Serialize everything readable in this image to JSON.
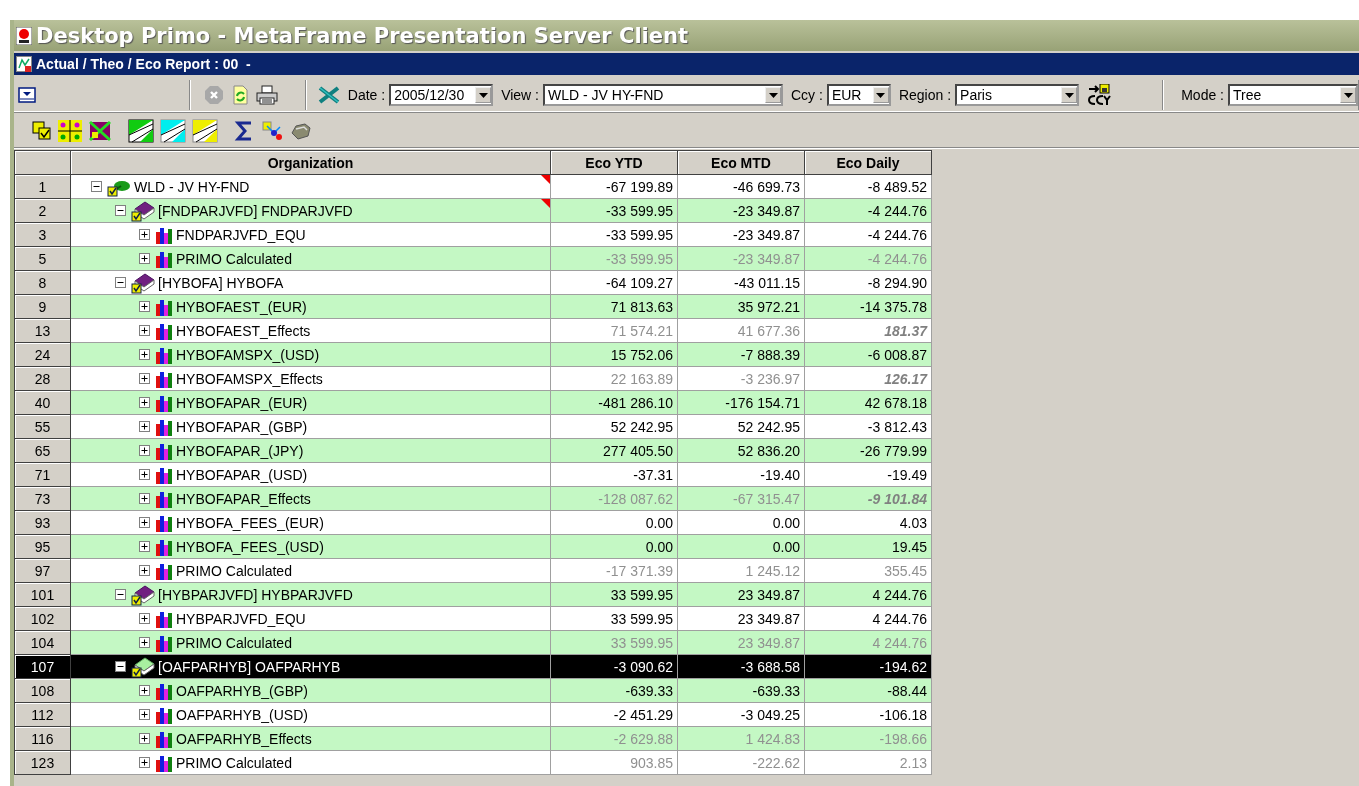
{
  "window": {
    "title": "Desktop Primo - MetaFrame Presentation Server Client"
  },
  "document": {
    "title": "Actual / Theo / Eco Report : 00  -"
  },
  "toolbar": {
    "filters": [
      {
        "label": "Date :",
        "value": "2005/12/30"
      },
      {
        "label": "View :",
        "value": "WLD - JV HY-FND"
      },
      {
        "label": "Ccy :",
        "value": "EUR"
      },
      {
        "label": "Region :",
        "value": "Paris"
      }
    ],
    "mode": {
      "label": "Mode :",
      "value": "Tree"
    }
  },
  "grid": {
    "columns": [
      "Organization",
      "Eco YTD",
      "Eco MTD",
      "Eco Daily"
    ],
    "rows": [
      {
        "number": "1",
        "label": "WLD - JV HY-FND",
        "kind": "root",
        "expanded": true,
        "selected": false,
        "flagged": true,
        "values": [
          {
            "text": "-67 199.89",
            "kind": "plain"
          },
          {
            "text": "-46 699.73",
            "kind": "plain"
          },
          {
            "text": "-8 489.52",
            "kind": "plain"
          }
        ],
        "children": [
          {
            "number": "2",
            "label": "[FNDPARJVFD] FNDPARJVFD",
            "kind": "book",
            "expanded": true,
            "selected": false,
            "flagged": true,
            "values": [
              {
                "text": "-33 599.95",
                "kind": "plain"
              },
              {
                "text": "-23 349.87",
                "kind": "plain"
              },
              {
                "text": "-4 244.76",
                "kind": "plain"
              }
            ],
            "children": [
              {
                "number": "3",
                "label": "FNDPARJVFD_EQU",
                "kind": "leaf",
                "expanded": false,
                "selected": false,
                "flagged": false,
                "values": [
                  {
                    "text": "-33 599.95",
                    "kind": "plain"
                  },
                  {
                    "text": "-23 349.87",
                    "kind": "plain"
                  },
                  {
                    "text": "-4 244.76",
                    "kind": "plain"
                  }
                ]
              },
              {
                "number": "5",
                "label": "PRIMO Calculated",
                "kind": "leaf",
                "expanded": false,
                "selected": false,
                "flagged": false,
                "values": [
                  {
                    "text": "-33 599.95",
                    "kind": "dim"
                  },
                  {
                    "text": "-23 349.87",
                    "kind": "dim"
                  },
                  {
                    "text": "-4 244.76",
                    "kind": "dim"
                  }
                ]
              }
            ]
          },
          {
            "number": "8",
            "label": "[HYBOFA] HYBOFA",
            "kind": "book",
            "expanded": true,
            "selected": false,
            "flagged": false,
            "values": [
              {
                "text": "-64 109.27",
                "kind": "plain"
              },
              {
                "text": "-43 011.15",
                "kind": "plain"
              },
              {
                "text": "-8 294.90",
                "kind": "plain"
              }
            ],
            "children": [
              {
                "number": "9",
                "label": "HYBOFAEST_(EUR)",
                "kind": "leaf",
                "expanded": false,
                "selected": false,
                "flagged": false,
                "values": [
                  {
                    "text": "71 813.63",
                    "kind": "plain"
                  },
                  {
                    "text": "35 972.21",
                    "kind": "plain"
                  },
                  {
                    "text": "-14 375.78",
                    "kind": "plain"
                  }
                ]
              },
              {
                "number": "13",
                "label": "HYBOFAEST_Effects",
                "kind": "leaf",
                "expanded": false,
                "selected": false,
                "flagged": false,
                "values": [
                  {
                    "text": "71 574.21",
                    "kind": "dim"
                  },
                  {
                    "text": "41 677.36",
                    "kind": "dim"
                  },
                  {
                    "text": "181.37",
                    "kind": "dim-bold"
                  }
                ]
              },
              {
                "number": "24",
                "label": "HYBOFAMSPX_(USD)",
                "kind": "leaf",
                "expanded": false,
                "selected": false,
                "flagged": false,
                "values": [
                  {
                    "text": "15 752.06",
                    "kind": "plain"
                  },
                  {
                    "text": "-7 888.39",
                    "kind": "plain"
                  },
                  {
                    "text": "-6 008.87",
                    "kind": "plain"
                  }
                ]
              },
              {
                "number": "28",
                "label": "HYBOFAMSPX_Effects",
                "kind": "leaf",
                "expanded": false,
                "selected": false,
                "flagged": false,
                "values": [
                  {
                    "text": "22 163.89",
                    "kind": "dim"
                  },
                  {
                    "text": "-3 236.97",
                    "kind": "dim"
                  },
                  {
                    "text": "126.17",
                    "kind": "dim-bold"
                  }
                ]
              },
              {
                "number": "40",
                "label": "HYBOFAPAR_(EUR)",
                "kind": "leaf",
                "expanded": false,
                "selected": false,
                "flagged": false,
                "values": [
                  {
                    "text": "-481 286.10",
                    "kind": "plain"
                  },
                  {
                    "text": "-176 154.71",
                    "kind": "plain"
                  },
                  {
                    "text": "42 678.18",
                    "kind": "plain"
                  }
                ]
              },
              {
                "number": "55",
                "label": "HYBOFAPAR_(GBP)",
                "kind": "leaf",
                "expanded": false,
                "selected": false,
                "flagged": false,
                "values": [
                  {
                    "text": "52 242.95",
                    "kind": "plain"
                  },
                  {
                    "text": "52 242.95",
                    "kind": "plain"
                  },
                  {
                    "text": "-3 812.43",
                    "kind": "plain"
                  }
                ]
              },
              {
                "number": "65",
                "label": "HYBOFAPAR_(JPY)",
                "kind": "leaf",
                "expanded": false,
                "selected": false,
                "flagged": false,
                "values": [
                  {
                    "text": "277 405.50",
                    "kind": "plain"
                  },
                  {
                    "text": "52 836.20",
                    "kind": "plain"
                  },
                  {
                    "text": "-26 779.99",
                    "kind": "plain"
                  }
                ]
              },
              {
                "number": "71",
                "label": "HYBOFAPAR_(USD)",
                "kind": "leaf",
                "expanded": false,
                "selected": false,
                "flagged": false,
                "values": [
                  {
                    "text": "-37.31",
                    "kind": "plain"
                  },
                  {
                    "text": "-19.40",
                    "kind": "plain"
                  },
                  {
                    "text": "-19.49",
                    "kind": "plain"
                  }
                ]
              },
              {
                "number": "73",
                "label": "HYBOFAPAR_Effects",
                "kind": "leaf",
                "expanded": false,
                "selected": false,
                "flagged": false,
                "values": [
                  {
                    "text": "-128 087.62",
                    "kind": "dim"
                  },
                  {
                    "text": "-67 315.47",
                    "kind": "dim"
                  },
                  {
                    "text": "-9 101.84",
                    "kind": "dim-bold"
                  }
                ]
              },
              {
                "number": "93",
                "label": "HYBOFA_FEES_(EUR)",
                "kind": "leaf",
                "expanded": false,
                "selected": false,
                "flagged": false,
                "values": [
                  {
                    "text": "0.00",
                    "kind": "plain"
                  },
                  {
                    "text": "0.00",
                    "kind": "plain"
                  },
                  {
                    "text": "4.03",
                    "kind": "plain"
                  }
                ]
              },
              {
                "number": "95",
                "label": "HYBOFA_FEES_(USD)",
                "kind": "leaf",
                "expanded": false,
                "selected": false,
                "flagged": false,
                "values": [
                  {
                    "text": "0.00",
                    "kind": "plain"
                  },
                  {
                    "text": "0.00",
                    "kind": "plain"
                  },
                  {
                    "text": "19.45",
                    "kind": "plain"
                  }
                ]
              },
              {
                "number": "97",
                "label": "PRIMO Calculated",
                "kind": "leaf",
                "expanded": false,
                "selected": false,
                "flagged": false,
                "values": [
                  {
                    "text": "-17 371.39",
                    "kind": "dim"
                  },
                  {
                    "text": "1 245.12",
                    "kind": "dim"
                  },
                  {
                    "text": "355.45",
                    "kind": "dim"
                  }
                ]
              }
            ]
          },
          {
            "number": "101",
            "label": "[HYBPARJVFD] HYBPARJVFD",
            "kind": "book",
            "expanded": true,
            "selected": false,
            "flagged": false,
            "values": [
              {
                "text": "33 599.95",
                "kind": "plain"
              },
              {
                "text": "23 349.87",
                "kind": "plain"
              },
              {
                "text": "4 244.76",
                "kind": "plain"
              }
            ],
            "children": [
              {
                "number": "102",
                "label": "HYBPARJVFD_EQU",
                "kind": "leaf",
                "expanded": false,
                "selected": false,
                "flagged": false,
                "values": [
                  {
                    "text": "33 599.95",
                    "kind": "plain"
                  },
                  {
                    "text": "23 349.87",
                    "kind": "plain"
                  },
                  {
                    "text": "4 244.76",
                    "kind": "plain"
                  }
                ]
              },
              {
                "number": "104",
                "label": "PRIMO Calculated",
                "kind": "leaf",
                "expanded": false,
                "selected": false,
                "flagged": false,
                "values": [
                  {
                    "text": "33 599.95",
                    "kind": "dim"
                  },
                  {
                    "text": "23 349.87",
                    "kind": "dim"
                  },
                  {
                    "text": "4 244.76",
                    "kind": "dim"
                  }
                ]
              }
            ]
          },
          {
            "number": "107",
            "label": "[OAFPARHYB] OAFPARHYB",
            "kind": "book",
            "expanded": true,
            "selected": true,
            "flagged": false,
            "values": [
              {
                "text": "-3 090.62",
                "kind": "plain"
              },
              {
                "text": "-3 688.58",
                "kind": "plain"
              },
              {
                "text": "-194.62",
                "kind": "plain"
              }
            ],
            "children": [
              {
                "number": "108",
                "label": "OAFPARHYB_(GBP)",
                "kind": "leaf",
                "expanded": false,
                "selected": false,
                "flagged": false,
                "values": [
                  {
                    "text": "-639.33",
                    "kind": "plain"
                  },
                  {
                    "text": "-639.33",
                    "kind": "plain"
                  },
                  {
                    "text": "-88.44",
                    "kind": "plain"
                  }
                ]
              },
              {
                "number": "112",
                "label": "OAFPARHYB_(USD)",
                "kind": "leaf",
                "expanded": false,
                "selected": false,
                "flagged": false,
                "values": [
                  {
                    "text": "-2 451.29",
                    "kind": "plain"
                  },
                  {
                    "text": "-3 049.25",
                    "kind": "plain"
                  },
                  {
                    "text": "-106.18",
                    "kind": "plain"
                  }
                ]
              },
              {
                "number": "116",
                "label": "OAFPARHYB_Effects",
                "kind": "leaf",
                "expanded": false,
                "selected": false,
                "flagged": false,
                "values": [
                  {
                    "text": "-2 629.88",
                    "kind": "dim"
                  },
                  {
                    "text": "1 424.83",
                    "kind": "dim"
                  },
                  {
                    "text": "-198.66",
                    "kind": "dim"
                  }
                ]
              },
              {
                "number": "123",
                "label": "PRIMO Calculated",
                "kind": "leaf",
                "expanded": false,
                "selected": false,
                "flagged": false,
                "values": [
                  {
                    "text": "903.85",
                    "kind": "dim"
                  },
                  {
                    "text": "-222.62",
                    "kind": "dim"
                  },
                  {
                    "text": "2.13",
                    "kind": "dim"
                  }
                ]
              }
            ]
          }
        ]
      }
    ]
  }
}
